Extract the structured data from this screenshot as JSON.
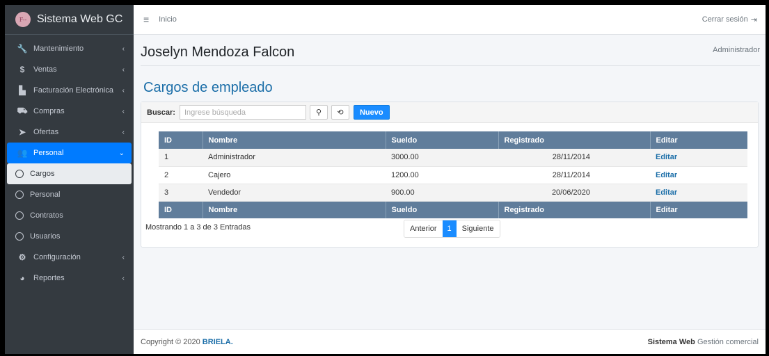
{
  "brand": {
    "logo_text": "F--",
    "title": "Sistema Web GC"
  },
  "sidebar": {
    "items": [
      {
        "icon": "wrench-icon",
        "glyph": "🔧",
        "label": "Mantenimiento"
      },
      {
        "icon": "dollar-icon",
        "glyph": "$",
        "label": "Ventas"
      },
      {
        "icon": "invoice-icon",
        "glyph": "▙",
        "label": "Facturación Electrónica"
      },
      {
        "icon": "cart-icon",
        "glyph": "⛟",
        "label": "Compras"
      },
      {
        "icon": "tags-icon",
        "glyph": "➤",
        "label": "Ofertas"
      }
    ],
    "active_group": {
      "icon": "users-icon",
      "glyph": "👥",
      "label": "Personal"
    },
    "sub_items": [
      "Cargos",
      "Personal",
      "Contratos",
      "Usuarios"
    ],
    "bottom_items": [
      {
        "icon": "gear-icon",
        "glyph": "⚙",
        "label": "Configuración"
      },
      {
        "icon": "pie-chart-icon",
        "glyph": "◕",
        "label": "Reportes"
      }
    ]
  },
  "topbar": {
    "home": "Inicio",
    "logout": "Cerrar sesión"
  },
  "header": {
    "user_name": "Joselyn Mendoza Falcon",
    "role": "Administrador"
  },
  "page": {
    "title": "Cargos de empleado"
  },
  "toolbar": {
    "search_label": "Buscar:",
    "search_placeholder": "Ingrese búsqueda",
    "new_button": "Nuevo"
  },
  "table": {
    "headers": [
      "ID",
      "Nombre",
      "Sueldo",
      "Registrado",
      "Editar"
    ],
    "rows": [
      {
        "id": "1",
        "nombre": "Administrador",
        "sueldo": "3000.00",
        "registrado": "28/11/2014",
        "editar": "Editar"
      },
      {
        "id": "2",
        "nombre": "Cajero",
        "sueldo": "1200.00",
        "registrado": "28/11/2014",
        "editar": "Editar"
      },
      {
        "id": "3",
        "nombre": "Vendedor",
        "sueldo": "900.00",
        "registrado": "20/06/2020",
        "editar": "Editar"
      }
    ]
  },
  "pagination": {
    "info": "Mostrando 1 a 3 de 3 Entradas",
    "prev": "Anterior",
    "current": "1",
    "next": "Siguiente"
  },
  "footer": {
    "copyright": "Copyright © 2020",
    "brand": "BRIELA.",
    "app_bold": "Sistema Web",
    "app_rest": "Gestión comercial"
  }
}
